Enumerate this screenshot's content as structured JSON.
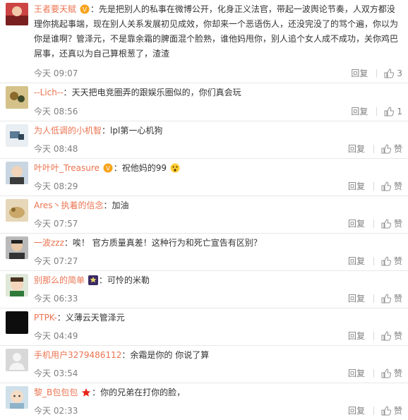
{
  "reply_label": "回复",
  "comments": [
    {
      "username": "王者要天赋",
      "text": "先是把别人的私事在微博公开，化身正义法官，带起一波舆论节奏，人双方都没理你挑起事端，现在别人关系发展初见成效，你却来一个恶语伤人，还没完没了的骂个遍，你以为你是谁啊？管泽元，不是靠余霜的脾面混个脸熟，谁他妈甩你，别人追个女人成不成功，关你鸡巴屌事，还真以为自己算根葱了，渣渣",
      "time": "今天 09:07",
      "like": "3",
      "badge": "vip-badge-icon"
    },
    {
      "username": "--Lich--",
      "text": "天天把电竞圈弄的跟娱乐圈似的，你们真会玩",
      "time": "今天 08:56",
      "like": "1"
    },
    {
      "username": "为人低调的小机智",
      "text": "lpl第一心机狗",
      "time": "今天 08:48",
      "like": "赞"
    },
    {
      "username": "叶叶叶_Treasure",
      "text": "祝他妈的99",
      "time": "今天 08:29",
      "like": "赞",
      "badge": "vip-badge-icon",
      "emoji": "shocked-emoji-icon"
    },
    {
      "username": "Ares丶执着的信念",
      "text": "加油",
      "time": "今天 07:57",
      "like": "赞"
    },
    {
      "username": "一波zzz",
      "text": "唉！ 官方质量真差！这种行为和死亡宣告有区别？",
      "time": "今天 07:27",
      "like": "赞"
    },
    {
      "username": "别那么的简单",
      "text": "可怜的米勒",
      "time": "今天 06:33",
      "like": "赞",
      "badge": "star-badge-icon"
    },
    {
      "username": "PTPK-",
      "text": "义薄云天管泽元",
      "time": "今天 04:49",
      "like": "赞"
    },
    {
      "username": "手机用户3279486112",
      "text": "余霜是你的  你说了算",
      "time": "今天 03:54",
      "like": "赞"
    },
    {
      "username": "黎_B包包包",
      "text": "你的兄弟在打你的脸，",
      "time": "今天 02:33",
      "like": "赞",
      "badge": "red-star-icon"
    }
  ]
}
